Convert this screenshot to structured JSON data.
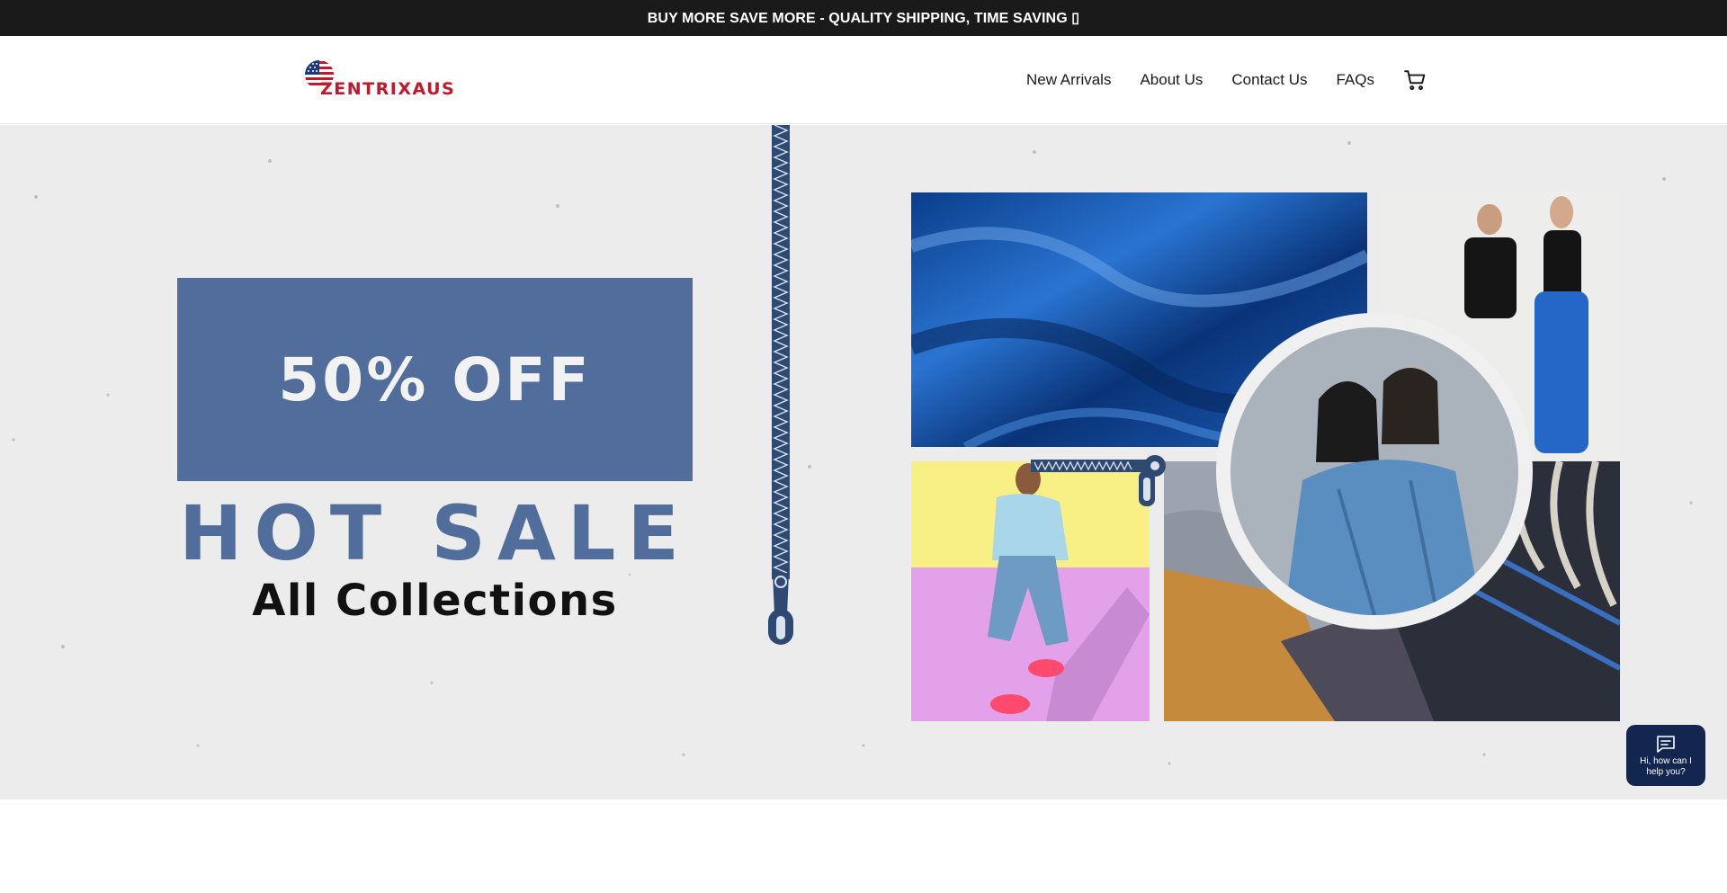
{
  "announcement": {
    "text": "BUY MORE SAVE MORE - QUALITY SHIPPING, TIME SAVING ▯"
  },
  "header": {
    "logo_text": "ZENTRIXAUS",
    "nav": [
      {
        "label": "New Arrivals"
      },
      {
        "label": "About Us"
      },
      {
        "label": "Contact Us"
      },
      {
        "label": "FAQs"
      }
    ],
    "cart_icon": "cart-icon"
  },
  "hero": {
    "promo": "50% OFF",
    "headline": "HOT SALE",
    "subheadline": "All Collections",
    "images": [
      "blue-velvet-fabric",
      "couple-black-and-blue-outfits",
      "colorful-sitting-model",
      "knit-sweaters-on-rack",
      "couple-denim-jackets"
    ]
  },
  "chat": {
    "icon": "chat-icon",
    "text": "Hi, how can I help you?"
  },
  "colors": {
    "announcement_bg": "#1a1a1a",
    "accent_blue": "#516d9b",
    "brand_red": "#c2182b",
    "chat_bg": "#13264f"
  }
}
